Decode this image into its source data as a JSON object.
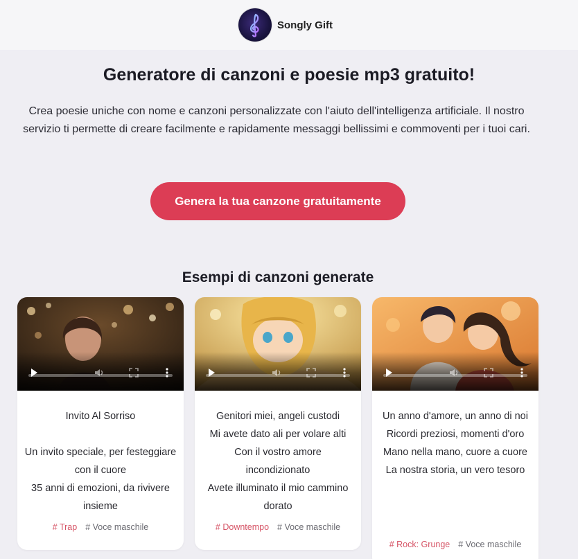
{
  "header": {
    "brand": "Songly Gift",
    "logo_icon": "treble-clef-icon"
  },
  "hero": {
    "title": "Generatore di canzoni e poesie mp3 gratuito!",
    "description": "Crea poesie uniche con nome e canzoni personalizzate con l'aiuto dell'intelligenza artificiale. Il nostro servizio ti permette di creare facilmente e rapidamente messaggi bellissimi e commoventi per i tuoi cari.",
    "cta_label": "Genera la tua canzone gratuitamente"
  },
  "examples": {
    "title": "Esempi di canzoni generate",
    "cards": [
      {
        "lines": [
          "Invito Al Sorriso",
          "",
          "Un invito speciale, per festeggiare con il cuore",
          "35 anni di emozioni, da rivivere insieme"
        ],
        "genre": "# Trap",
        "voice": "# Voce maschile"
      },
      {
        "lines": [
          "Genitori miei, angeli custodi",
          "Mi avete dato ali per volare alti",
          "Con il vostro amore incondizionato",
          "Avete illuminato il mio cammino dorato"
        ],
        "genre": "# Downtempo",
        "voice": "# Voce maschile"
      },
      {
        "lines": [
          "Un anno d'amore, un anno di noi",
          "Ricordi preziosi, momenti d'oro",
          "Mano nella mano, cuore a cuore",
          "La nostra storia, un vero tesoro"
        ],
        "genre": "# Rock: Grunge",
        "voice": "# Voce maschile"
      }
    ]
  },
  "colors": {
    "accent": "#dc3d55",
    "tag_genre": "#d65466",
    "background": "#efeef3"
  }
}
